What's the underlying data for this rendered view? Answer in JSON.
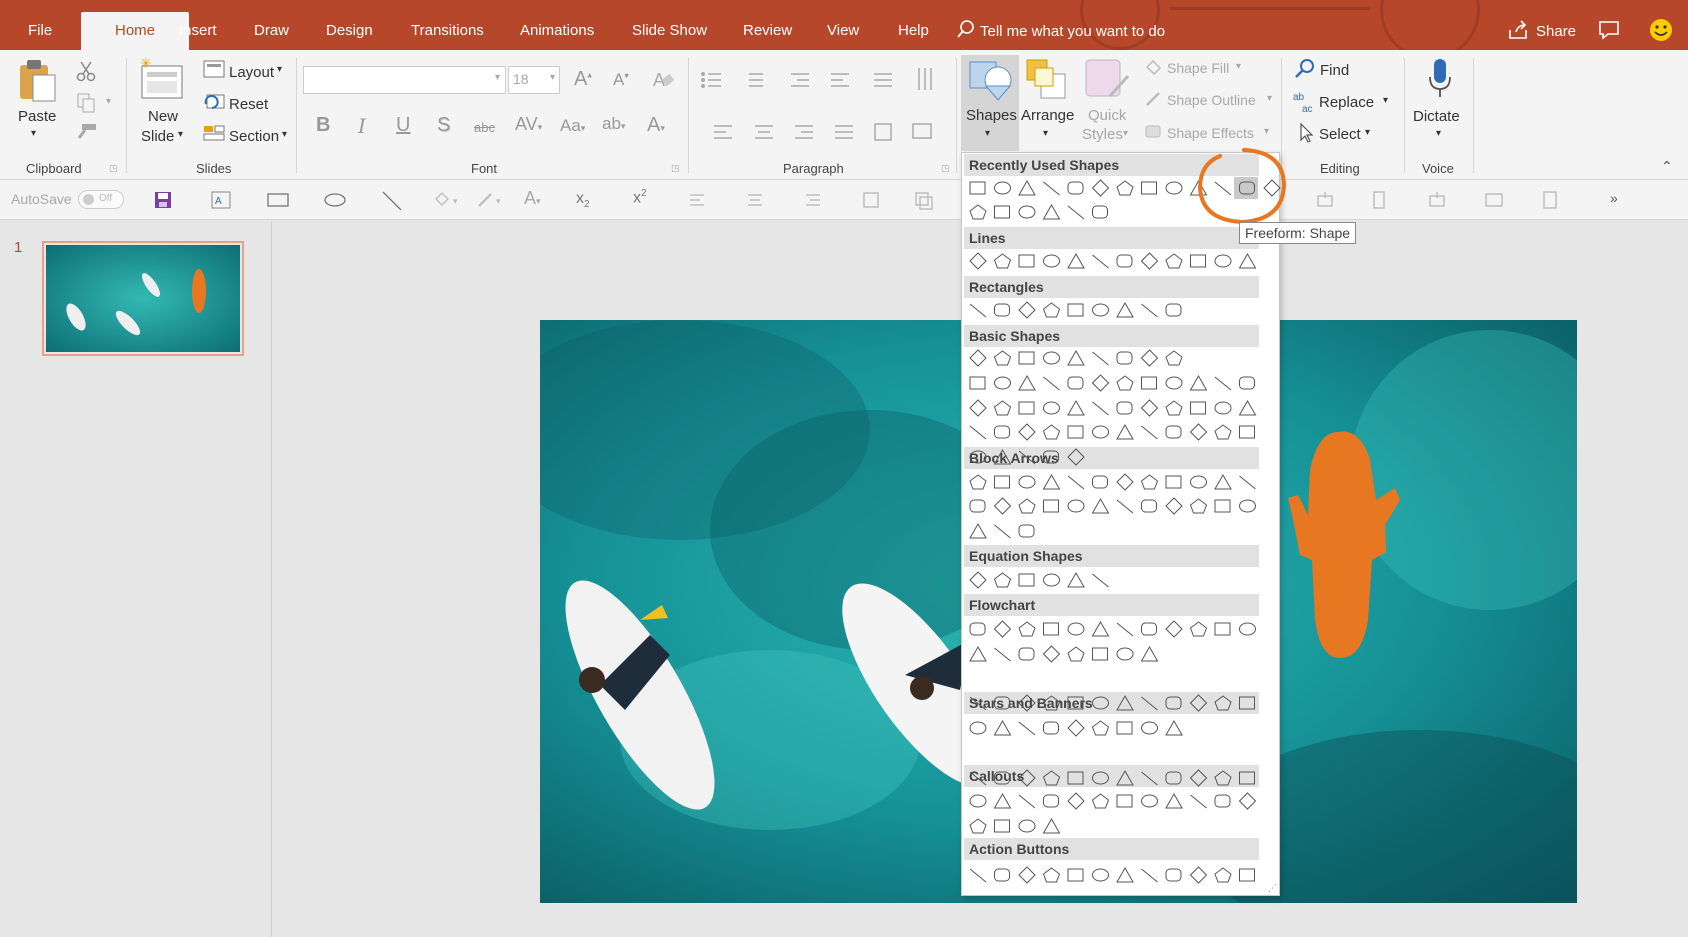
{
  "tabs": [
    "File",
    "Home",
    "Insert",
    "Draw",
    "Design",
    "Transitions",
    "Animations",
    "Slide Show",
    "Review",
    "View",
    "Help"
  ],
  "active_tab": "Home",
  "tell_me": "Tell me what you want to do",
  "share": "Share",
  "ribbon": {
    "clipboard": {
      "paste": "Paste",
      "label": "Clipboard"
    },
    "slides": {
      "new_slide_1": "New",
      "new_slide_2": "Slide",
      "layout": "Layout",
      "reset": "Reset",
      "section": "Section",
      "label": "Slides"
    },
    "font": {
      "size": "18",
      "label": "Font"
    },
    "paragraph": {
      "label": "Paragraph"
    },
    "drawing": {
      "shapes": "Shapes",
      "arrange": "Arrange",
      "quick_styles_1": "Quick",
      "quick_styles_2": "Styles",
      "shape_fill": "Shape Fill",
      "shape_outline": "Shape Outline",
      "shape_effects": "Shape Effects"
    },
    "editing": {
      "find": "Find",
      "replace": "Replace",
      "select": "Select",
      "label": "Editing"
    },
    "voice": {
      "dictate": "Dictate",
      "label": "Voice"
    }
  },
  "qat": {
    "autosave": "AutoSave",
    "autosave_state": "Off"
  },
  "thumbnail": {
    "number": "1"
  },
  "gallery": {
    "categories": [
      "Recently Used Shapes",
      "Lines",
      "Rectangles",
      "Basic Shapes",
      "Block Arrows",
      "Equation Shapes",
      "Flowchart",
      "Stars and Banners",
      "Callouts",
      "Action Buttons"
    ],
    "tooltip": "Freeform: Shape"
  },
  "colors": {
    "accent": "#b7472a",
    "ribbon": "#f4f4f4",
    "annotation": "#e87722",
    "water": "#1a9a9c"
  }
}
